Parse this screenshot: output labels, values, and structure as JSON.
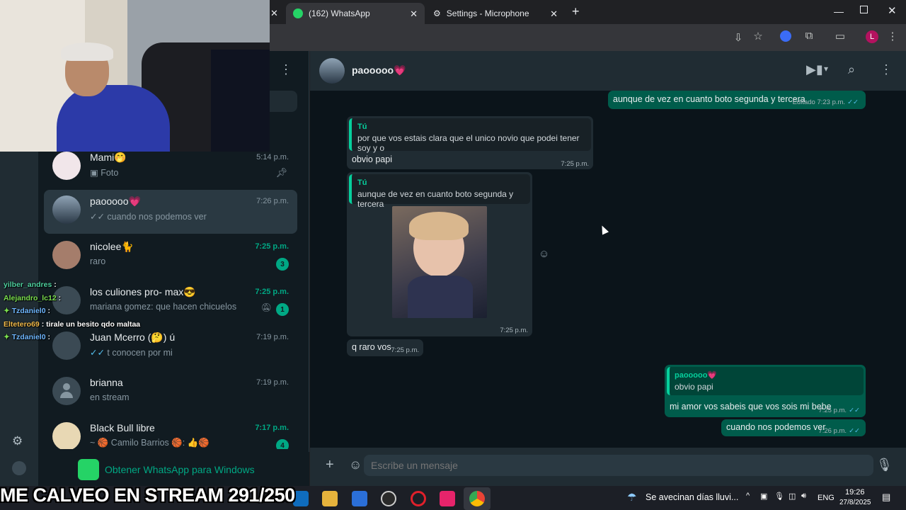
{
  "browser": {
    "tabs": [
      {
        "label": "(162) WhatsApp",
        "active": true
      },
      {
        "label": "Settings - Microphone",
        "active": false
      }
    ],
    "new_tab": "+",
    "profile_initial": "L"
  },
  "sidebar": {
    "chats": [
      {
        "name": "Mami🤭",
        "preview": "Foto",
        "time": "5:14 p.m.",
        "pinned": true
      },
      {
        "name": "paooooo💗",
        "preview": "cuando nos podemos ver",
        "time": "7:26 p.m.",
        "selected": true
      },
      {
        "name": "nicolee🐈",
        "preview": "raro",
        "time": "7:25 p.m.",
        "unread": "3"
      },
      {
        "name": "los culiones pro- max😎",
        "preview": "mariana gomez: que hacen chicuelos",
        "time": "7:25 p.m.",
        "unread": "1",
        "muted": true
      },
      {
        "name": "Juan Mcerro (🤔) ú",
        "preview": "t conocen por mi",
        "time": "7:19 p.m."
      },
      {
        "name": "brianna",
        "preview": "en stream",
        "time": "7:19 p.m."
      },
      {
        "name": "Black Bull libre",
        "preview": "~ 🏀 Camilo Barrios 🏀: 👍🏀",
        "time": "7:17 p.m.",
        "unread": "4"
      }
    ],
    "download_banner": "Obtener WhatsApp para Windows"
  },
  "chat": {
    "contact_name": "paooooo💗",
    "messages": [
      {
        "dir": "out",
        "text": "aunque de vez en cuanto boto segunda y tercera",
        "edited": "Editado",
        "time": "7:23 p.m."
      },
      {
        "dir": "in",
        "quote_author": "Tú",
        "quote_text": "por que vos estais clara que el unico novio que podei tener soy y o",
        "text": "obvio papi",
        "time": "7:25 p.m."
      },
      {
        "dir": "in",
        "quote_author": "Tú",
        "quote_text": "aunque de vez en cuanto boto segunda y tercera",
        "image": true,
        "time": "7:25 p.m."
      },
      {
        "dir": "in",
        "text": "q raro vos",
        "time": "7:25 p.m."
      },
      {
        "dir": "out",
        "quote_author": "paooooo💗",
        "quote_text": "obvio papi",
        "text": "mi amor vos sabeis que vos sois mi bebe",
        "time": "7:25 p.m."
      },
      {
        "dir": "out",
        "text": "cuando nos podemos ver",
        "time": "7:26 p.m."
      }
    ],
    "composer_placeholder": "Escribe un mensaje"
  },
  "stream_overlay": {
    "chat_lines": [
      {
        "user": "yilber_andres",
        "msg": "",
        "color": "#4fd1a0"
      },
      {
        "user": "Alejandro_lc12",
        "msg": "",
        "color": "#7be04f"
      },
      {
        "user": "Tzdaniel0",
        "msg": "",
        "color": "#6fb7ff"
      },
      {
        "user": "Eltetero69",
        "msg": "tirale un besito qdo maltaa",
        "color": "#f0b94a"
      },
      {
        "user": "Tzdaniel0",
        "msg": "",
        "color": "#6fb7ff"
      }
    ],
    "banner": "ME CALVEO EN STREAM 291/250"
  },
  "taskbar": {
    "weather": "Se avecinan días lluvi...",
    "language": "ENG",
    "time": "19:26",
    "date": "27/8/2025"
  },
  "colors": {
    "accent": "#00a884",
    "outgoing": "#005c4b",
    "incoming": "#202c33"
  }
}
